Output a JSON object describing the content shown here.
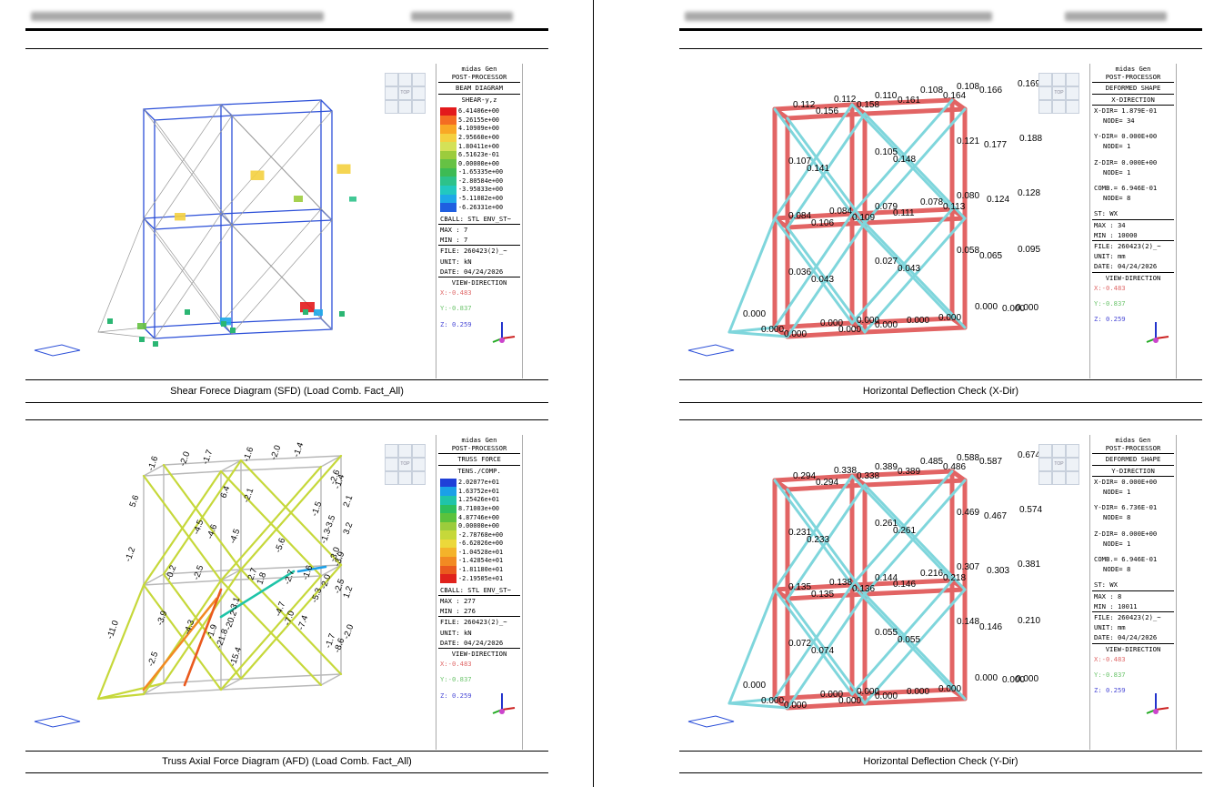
{
  "header": {
    "title_blurred": "",
    "right_blurred": ""
  },
  "colors": {
    "frame": "#2b4fd8",
    "truss": "#7d7d7d",
    "red_member": "#e26464",
    "cyan_member": "#7fd6dc"
  },
  "panels": [
    {
      "id": "sfd",
      "caption": "Shear Forece Diagram (SFD) (Load Comb. Fact_All)",
      "info": {
        "title1": "midas Gen",
        "title2": "POST-PROCESSOR",
        "diagram": "BEAM DIAGRAM",
        "component": "SHEAR-y,z",
        "legend": [
          {
            "value": "6.41406e+00",
            "color": "#e31a1c"
          },
          {
            "value": "5.26155e+00",
            "color": "#f46d22"
          },
          {
            "value": "4.10909e+00",
            "color": "#f9a825"
          },
          {
            "value": "2.95660e+00",
            "color": "#f4d03f"
          },
          {
            "value": "1.80411e+00",
            "color": "#d4e157"
          },
          {
            "value": "6.51623e-01",
            "color": "#9ccc3c"
          },
          {
            "value": "0.00000e+00",
            "color": "#66c244"
          },
          {
            "value": "-1.65335e+00",
            "color": "#3dbb54"
          },
          {
            "value": "-2.80584e+00",
            "color": "#2dc28a"
          },
          {
            "value": "-3.95833e+00",
            "color": "#22c8c0"
          },
          {
            "value": "-5.11082e+00",
            "color": "#1ea8e8"
          },
          {
            "value": "-6.26331e+00",
            "color": "#1f5fe0"
          }
        ],
        "cball": "CBALL: STL ENV_ST~",
        "max": "MAX : 7",
        "min": "MIN : 7",
        "file": "FILE: 260423(2)_~",
        "unit": "UNIT: kN",
        "date": "DATE: 04/24/2026",
        "view": "VIEW-DIRECTION",
        "x": "X:-0.483",
        "y": "Y:-0.837",
        "z": "Z: 0.259"
      }
    },
    {
      "id": "defx",
      "caption": "Horizontal Deflection Check (X-Dir)",
      "labels": [
        "0.112",
        "0.156",
        "0.112",
        "0.158",
        "0.110",
        "0.161",
        "0.108",
        "0.164",
        "0.108",
        "0.166",
        "0.169",
        "0.107",
        "0.141",
        "0.105",
        "0.148",
        "0.121",
        "0.177",
        "0.188",
        "0.084",
        "0.106",
        "0.084",
        "0.109",
        "0.079",
        "0.111",
        "0.078",
        "0.113",
        "0.080",
        "0.124",
        "0.128",
        "0.058",
        "0.065",
        "0.095",
        "0.036",
        "0.043",
        "0.027",
        "0.043",
        "0.000",
        "0.000",
        "0.000",
        "0.000",
        "0.000",
        "0.000",
        "0.000",
        "0.000",
        "0.000",
        "0.000",
        "0.000",
        "0.000"
      ],
      "info": {
        "title1": "midas Gen",
        "title2": "POST-PROCESSOR",
        "diagram": "DEFORMED SHAPE",
        "component": "X-DIRECTION",
        "lines": [
          "X-DIR= 1.879E-01",
          "NODE= 34",
          "Y-DIR= 0.000E+00",
          "NODE= 1",
          "Z-DIR= 0.000E+00",
          "NODE= 1",
          "COMB.= 6.946E-01",
          "NODE= 8",
          "ST: WX"
        ],
        "max": "MAX : 34",
        "min": "MIN : 10000",
        "file": "FILE: 260423(2)_~",
        "unit": "UNIT: mm",
        "date": "DATE: 04/24/2026",
        "view": "VIEW-DIRECTION",
        "x": "X:-0.483",
        "y": "Y:-0.837",
        "z": "Z: 0.259"
      }
    },
    {
      "id": "afd",
      "caption": "Truss Axial Force Diagram (AFD) (Load Comb. Fact_All)",
      "labels": [
        "-1.6",
        "-2.0",
        "-1.7",
        "-1.6",
        "-2.0",
        "-1.4",
        "-2.6",
        "5.6",
        "6.4",
        "-2.1",
        "-1.4",
        "2.1",
        "-1.2",
        "-4.5",
        "-4.6",
        "-4.5",
        "-5.6",
        "-1.3",
        "-0.2",
        "-2.5",
        "2.7",
        "1.8",
        "-2.7",
        "-1.6",
        "-2.0",
        "-2.5",
        "1.2",
        "-1.5",
        "-3.5",
        "3.2",
        "-3.0",
        "-3.9",
        "-5.3",
        "-11.0",
        "-3.9",
        "-4.3",
        "-1.9",
        "-21.8",
        "-3.1",
        "-4.7",
        "-20.2",
        "-7.0",
        "-7.4",
        "-15.4",
        "-2.5",
        "-1.7",
        "-8.6",
        "-2.0"
      ],
      "info": {
        "title1": "midas Gen",
        "title2": "POST-PROCESSOR",
        "diagram": "TRUSS FORCE",
        "component": "TENS./COMP.",
        "legend": [
          {
            "value": "2.02077e+01",
            "color": "#1f3fd8"
          },
          {
            "value": "1.63752e+01",
            "color": "#1aa0e8"
          },
          {
            "value": "1.25426e+01",
            "color": "#1fc4a8"
          },
          {
            "value": "8.71003e+00",
            "color": "#2dbf5c"
          },
          {
            "value": "4.87746e+00",
            "color": "#5cc23c"
          },
          {
            "value": "0.00000e+00",
            "color": "#9ccc3c"
          },
          {
            "value": "-2.78768e+00",
            "color": "#c6d83a"
          },
          {
            "value": "-6.62026e+00",
            "color": "#ecd83a"
          },
          {
            "value": "-1.04528e+01",
            "color": "#f4b32a"
          },
          {
            "value": "-1.42854e+01",
            "color": "#f28a22"
          },
          {
            "value": "-1.81180e+01",
            "color": "#ea5a1e"
          },
          {
            "value": "-2.19505e+01",
            "color": "#e0221c"
          }
        ],
        "cball": "CBALL: STL ENV_ST~",
        "max": "MAX : 277",
        "min": "MIN : 276",
        "file": "FILE: 260423(2)_~",
        "unit": "UNIT: kN",
        "date": "DATE: 04/24/2026",
        "view": "VIEW-DIRECTION",
        "x": "X:-0.483",
        "y": "Y:-0.837",
        "z": "Z: 0.259"
      }
    },
    {
      "id": "defy",
      "caption": "Horizontal Deflection Check (Y-Dir)",
      "labels": [
        "0.294",
        "0.294",
        "0.338",
        "0.338",
        "0.389",
        "0.389",
        "0.485",
        "0.486",
        "0.588",
        "0.587",
        "0.674",
        "0.231",
        "0.233",
        "0.261",
        "0.261",
        "0.469",
        "0.467",
        "0.574",
        "0.135",
        "0.135",
        "0.138",
        "0.136",
        "0.144",
        "0.146",
        "0.216",
        "0.218",
        "0.307",
        "0.303",
        "0.381",
        "0.148",
        "0.146",
        "0.210",
        "0.072",
        "0.074",
        "0.055",
        "0.055",
        "0.000",
        "0.000",
        "0.000",
        "0.000",
        "0.000",
        "0.000",
        "0.000",
        "0.000",
        "0.000",
        "0.000",
        "0.000",
        "0.000"
      ],
      "info": {
        "title1": "midas Gen",
        "title2": "POST-PROCESSOR",
        "diagram": "DEFORMED SHAPE",
        "component": "Y-DIRECTION",
        "lines": [
          "X-DIR= 0.000E+00",
          "NODE= 1",
          "Y-DIR= 6.736E-01",
          "NODE= 8",
          "Z-DIR= 0.000E+00",
          "NODE= 1",
          "COMB.= 6.946E-01",
          "NODE= 8",
          "ST: WX"
        ],
        "max": "MAX : 8",
        "min": "MIN : 10011",
        "file": "FILE: 260423(2)_~",
        "unit": "UNIT: mm",
        "date": "DATE: 04/24/2026",
        "view": "VIEW-DIRECTION",
        "x": "X:-0.483",
        "y": "Y:-0.837",
        "z": "Z: 0.259"
      }
    }
  ]
}
